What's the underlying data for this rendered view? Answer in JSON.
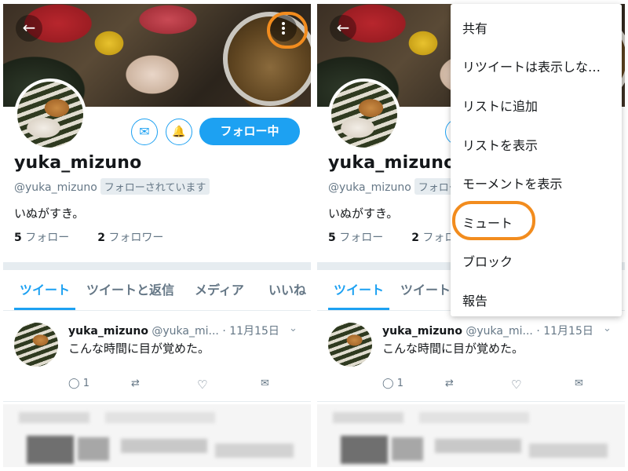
{
  "profile": {
    "display_name": "yuka_mizuno",
    "handle": "@yuka_mizuno",
    "follows_you": "フォローされています",
    "bio": "いぬがすき。",
    "following_count": "5",
    "following_label": "フォロー",
    "followers_count": "2",
    "followers_label": "フォロワー",
    "follow_button": "フォロー中",
    "back_glyph": "←",
    "message_glyph": "✉",
    "notify_glyph": "🔔"
  },
  "tabs": [
    "ツイート",
    "ツイートと返信",
    "メディア",
    "いいね"
  ],
  "tweet": {
    "name": "yuka_mizuno",
    "handle": "@yuka_mi...",
    "sep": "·",
    "date": "11月15日",
    "chevron": "⌄",
    "text": "こんな時間に目が覚めた。",
    "reply_glyph": "◯",
    "reply_count": "1",
    "retweet_glyph": "⇄",
    "like_glyph": "♡",
    "dm_glyph": "✉"
  },
  "menu": {
    "items": [
      "共有",
      "リツイートは表示しな…",
      "リストに追加",
      "リストを表示",
      "モーメントを表示",
      "ミュート",
      "ブロック",
      "報告"
    ],
    "highlighted": "ミュート"
  },
  "colors": {
    "accent": "#1da1f2",
    "highlight": "#f28c1e"
  }
}
